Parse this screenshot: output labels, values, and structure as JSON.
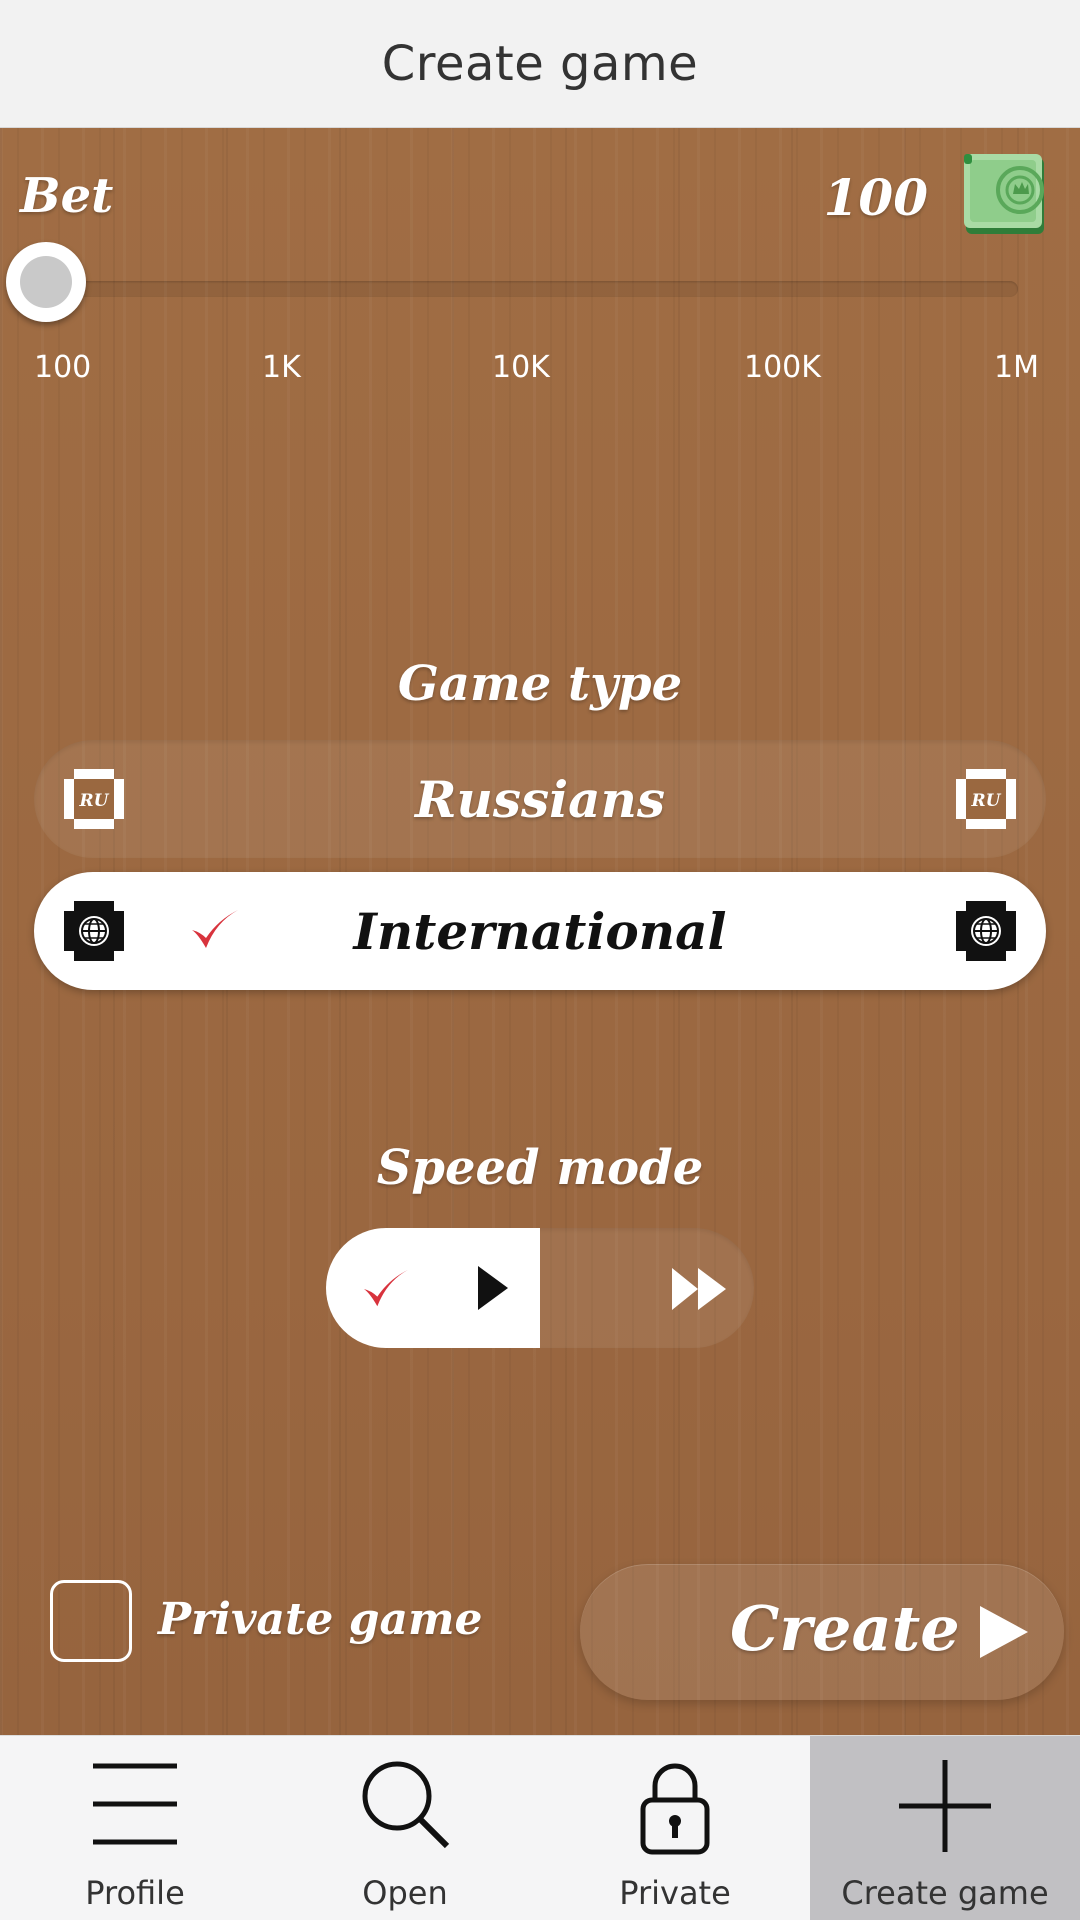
{
  "header": {
    "title": "Create game"
  },
  "bet": {
    "label": "Bet",
    "value": "100",
    "slider_fraction": 0,
    "ticks": [
      "100",
      "1K",
      "10K",
      "100K",
      "1M"
    ]
  },
  "game_type": {
    "title": "Game type",
    "options": [
      {
        "label": "Russians",
        "icon": "ru-flag-icon",
        "icon_text": "RU",
        "selected": false
      },
      {
        "label": "International",
        "icon": "globe-icon",
        "selected": true
      }
    ]
  },
  "speed_mode": {
    "title": "Speed mode",
    "options": [
      {
        "icon": "play-icon",
        "selected": true
      },
      {
        "icon": "fast-forward-icon",
        "selected": false
      }
    ]
  },
  "private_game": {
    "label": "Private game",
    "checked": false
  },
  "create_button": {
    "label": "Create"
  },
  "tabs": [
    {
      "label": "Profile",
      "icon": "menu-icon",
      "active": false
    },
    {
      "label": "Open",
      "icon": "search-icon",
      "active": false
    },
    {
      "label": "Private",
      "icon": "lock-icon",
      "active": false
    },
    {
      "label": "Create game",
      "icon": "plus-icon",
      "active": true
    }
  ],
  "colors": {
    "wood": "#9a6840",
    "check_red": "#d8333d",
    "money_green": "#3f9a48",
    "tab_active": "#c1c0c3"
  }
}
